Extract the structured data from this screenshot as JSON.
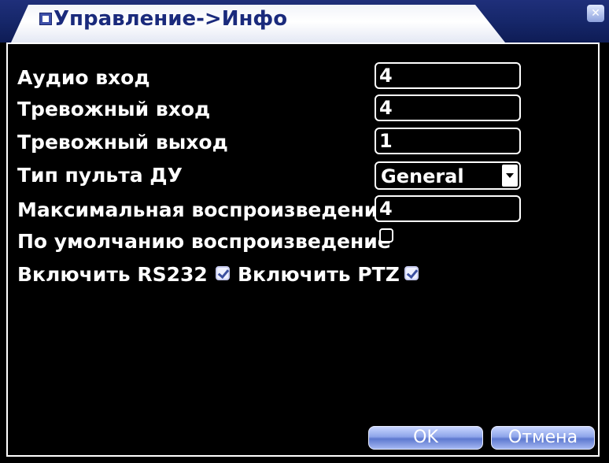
{
  "window": {
    "title": "Управление->Инфо",
    "title_icon": "window-icon",
    "close_icon": "close-icon"
  },
  "fields": {
    "audio_in": {
      "label": "Аудио вход",
      "value": "4"
    },
    "alarm_in": {
      "label": "Тревожный вход",
      "value": "4"
    },
    "alarm_out": {
      "label": "Тревожный выход",
      "value": "1"
    },
    "remote_type": {
      "label": "Тип пульта ДУ",
      "value": "General"
    },
    "max_playback": {
      "label": "Максимальная воспроизведения",
      "value": "4"
    },
    "default_playback": {
      "label": "По умолчанию воспроизведение",
      "checked": false
    },
    "enable_rs232": {
      "label": "Включить RS232",
      "checked": true
    },
    "enable_ptz": {
      "label": "Включить PTZ",
      "checked": true
    }
  },
  "buttons": {
    "ok": "OK",
    "cancel": "Отмена"
  },
  "colors": {
    "background": "#000000",
    "title_text": "#1a2a7c",
    "button_blue": "#7f97e3"
  }
}
